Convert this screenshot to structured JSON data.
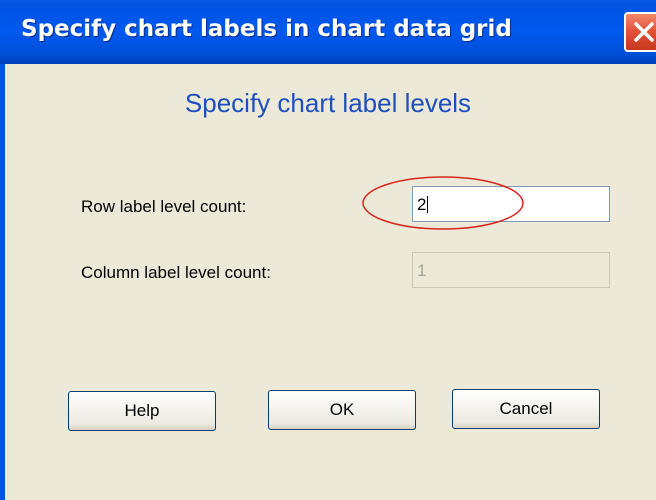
{
  "window": {
    "title": "Specify chart labels in chart data grid"
  },
  "dialog": {
    "heading": "Specify chart label levels",
    "row_label": "Row label level count:",
    "row_value": "2",
    "column_label": "Column label level count:",
    "column_value": "1"
  },
  "buttons": {
    "help": "Help",
    "ok": "OK",
    "cancel": "Cancel"
  },
  "colors": {
    "titlebar": "#0054e3",
    "heading": "#1d4fc0",
    "annotation": "#d9261c",
    "background": "#ece9d8"
  },
  "icons": {
    "close": "close-icon"
  }
}
